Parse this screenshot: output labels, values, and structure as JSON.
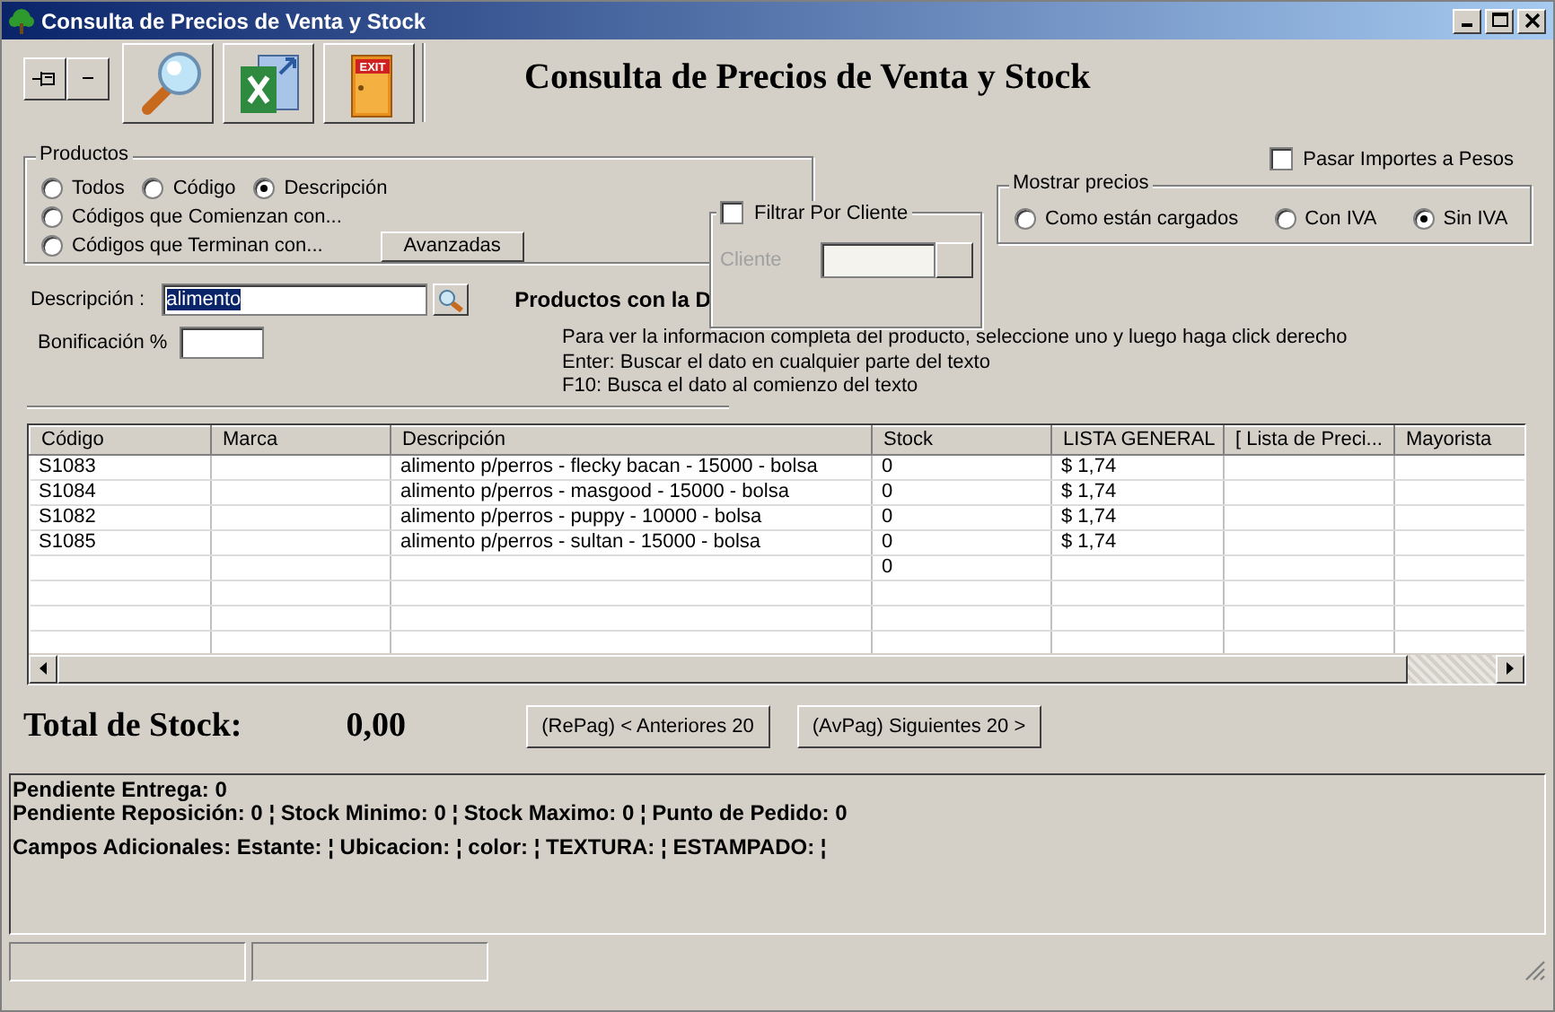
{
  "window": {
    "title": "Consulta de Precios de Venta y Stock"
  },
  "toolbar": {
    "exit_sign": "EXIT"
  },
  "heading": "Consulta de Precios de Venta y Stock",
  "productos": {
    "legend": "Productos",
    "rows": [
      [
        {
          "label": "Todos",
          "selected": false
        },
        {
          "label": "Código",
          "selected": false
        },
        {
          "label": "Descripción",
          "selected": true
        }
      ],
      [
        {
          "label": "Códigos que Comienzan con...",
          "selected": false
        }
      ],
      [
        {
          "label": "Códigos que Terminan con...",
          "selected": false
        }
      ]
    ],
    "advanced_button": "Avanzadas"
  },
  "descripcion": {
    "label": "Descripción :",
    "value": "alimento"
  },
  "result_heading": "Productos con la D",
  "bonificacion": {
    "label": "Bonificación %"
  },
  "client_filter": {
    "label": "Filtrar Por Cliente",
    "checked": false,
    "field_label": "Cliente",
    "disabled": true
  },
  "pasar_importes": {
    "label": "Pasar Importes a Pesos",
    "checked": false
  },
  "mostrar_precios": {
    "legend": "Mostrar precios",
    "options": [
      {
        "label": "Como están cargados",
        "selected": false
      },
      {
        "label": "Con IVA",
        "selected": false
      },
      {
        "label": "Sin IVA",
        "selected": true
      }
    ]
  },
  "help_lines": [
    "Para ver la informacion completa del producto, seleccione uno y luego haga click derecho",
    "Enter: Buscar el dato en cualquier parte del texto",
    "F10: Busca el dato al comienzo del texto"
  ],
  "table": {
    "columns": [
      "Código",
      "Marca",
      "Descripción",
      "Stock",
      "LISTA GENERAL",
      "[ Lista de Preci...",
      "Mayorista"
    ],
    "rows": [
      [
        "S1083",
        null,
        "alimento p/perros - flecky bacan - 15000 - bolsa",
        "0",
        "$ 1,74",
        null,
        null
      ],
      [
        "S1084",
        null,
        "alimento p/perros - masgood - 15000 - bolsa",
        "0",
        "$ 1,74",
        null,
        null
      ],
      [
        "S1082",
        null,
        "alimento p/perros - puppy - 10000 - bolsa",
        "0",
        "$ 1,74",
        null,
        null
      ],
      [
        "S1085",
        null,
        "alimento p/perros - sultan - 15000 - bolsa",
        "0",
        "$ 1,74",
        null,
        null
      ],
      [
        null,
        null,
        null,
        "0",
        null,
        null,
        null
      ]
    ]
  },
  "totals": {
    "label": "Total de Stock:",
    "value": "0,00"
  },
  "paging_buttons": [
    "(RePag) < Anteriores 20",
    "(AvPag) Siguientes 20 >"
  ],
  "details": [
    "Pendiente Entrega: 0",
    "Pendiente Reposición: 0 ¦ Stock Minimo: 0 ¦ Stock Maximo: 0 ¦ Punto de Pedido: 0",
    "Campos Adicionales: Estante: ¦ Ubicacion: ¦ color: ¦ TEXTURA: ¦ ESTAMPADO: ¦"
  ]
}
